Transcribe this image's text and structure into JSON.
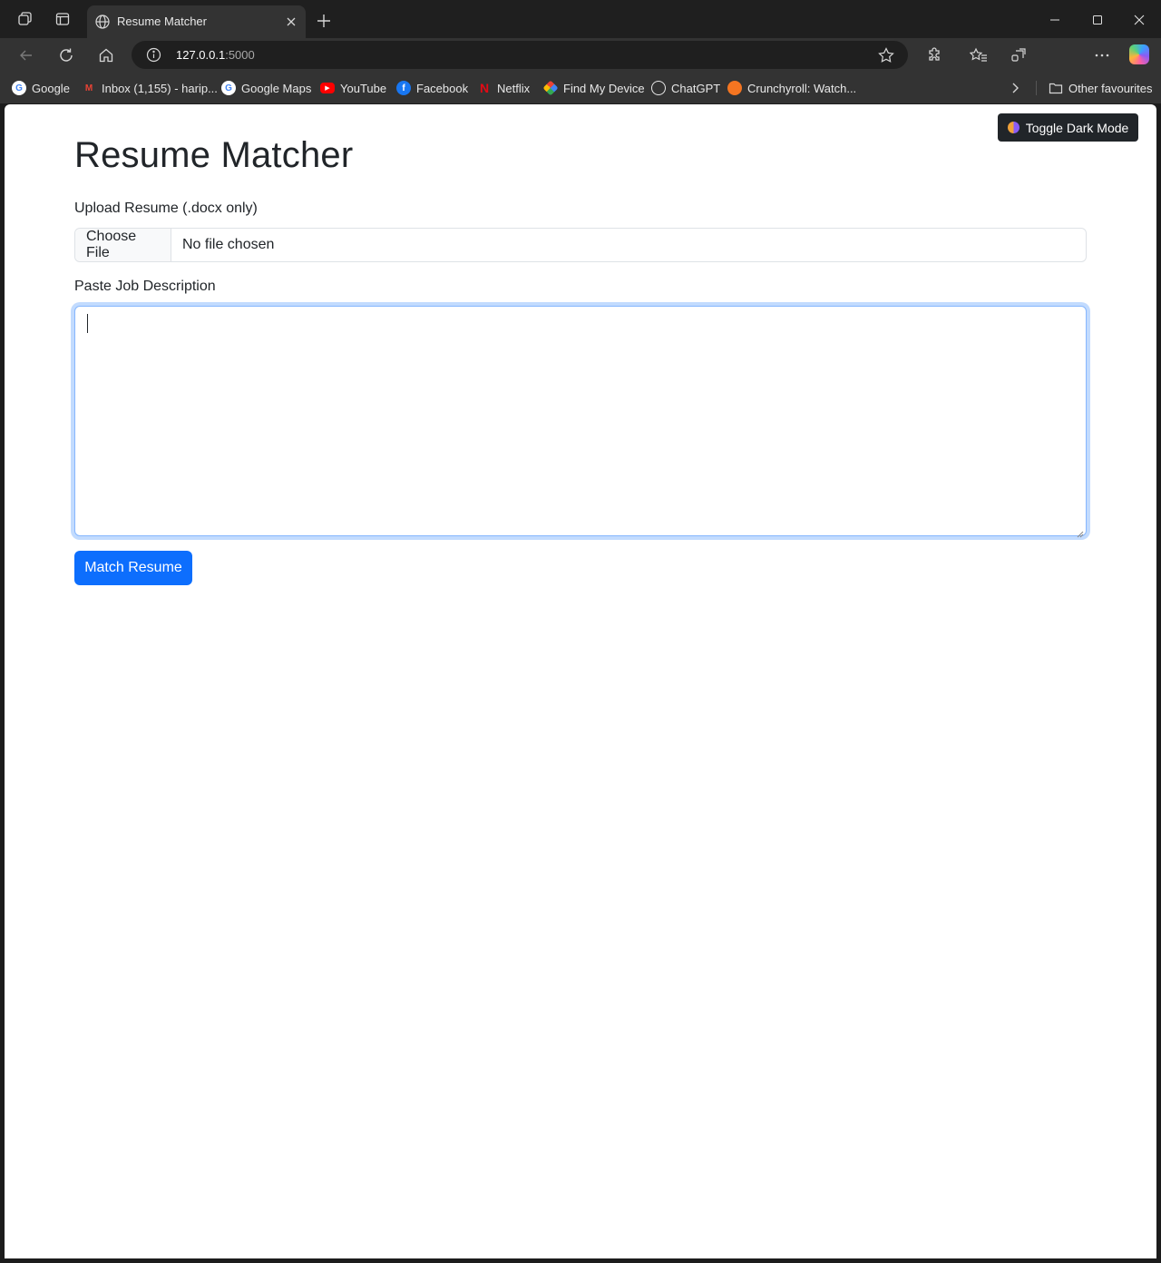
{
  "browser": {
    "tab_title": "Resume Matcher",
    "url_host": "127.0.0.1",
    "url_port": ":5000"
  },
  "bookmarks": [
    {
      "label": "Google",
      "icon": "google-icon",
      "color": "#4285f4"
    },
    {
      "label": "Inbox (1,155) - harip...",
      "icon": "gmail-icon",
      "color": "#ea4335"
    },
    {
      "label": "Google Maps",
      "icon": "google-icon",
      "color": "#4285f4"
    },
    {
      "label": "YouTube",
      "icon": "youtube-icon",
      "color": "#ff0000"
    },
    {
      "label": "Facebook",
      "icon": "facebook-icon",
      "color": "#1877f2"
    },
    {
      "label": "Netflix",
      "icon": "netflix-icon",
      "color": "#e50914"
    },
    {
      "label": "Find My Device",
      "icon": "find-my-device-icon",
      "color": "#34a853"
    },
    {
      "label": "ChatGPT",
      "icon": "chatgpt-icon",
      "color": "#ffffff"
    },
    {
      "label": "Crunchyroll: Watch...",
      "icon": "crunchyroll-icon",
      "color": "#f47521"
    }
  ],
  "other_favourites": "Other favourites",
  "page": {
    "toggle_label": "Toggle Dark Mode",
    "title": "Resume Matcher",
    "upload_label": "Upload Resume (.docx only)",
    "file_button": "Choose File",
    "file_status": "No file chosen",
    "jd_label": "Paste Job Description",
    "jd_value": "",
    "submit_label": "Match Resume"
  },
  "colors": {
    "primary": "#0d6efd",
    "dark_button": "#212529",
    "browser_chrome": "#333333"
  }
}
